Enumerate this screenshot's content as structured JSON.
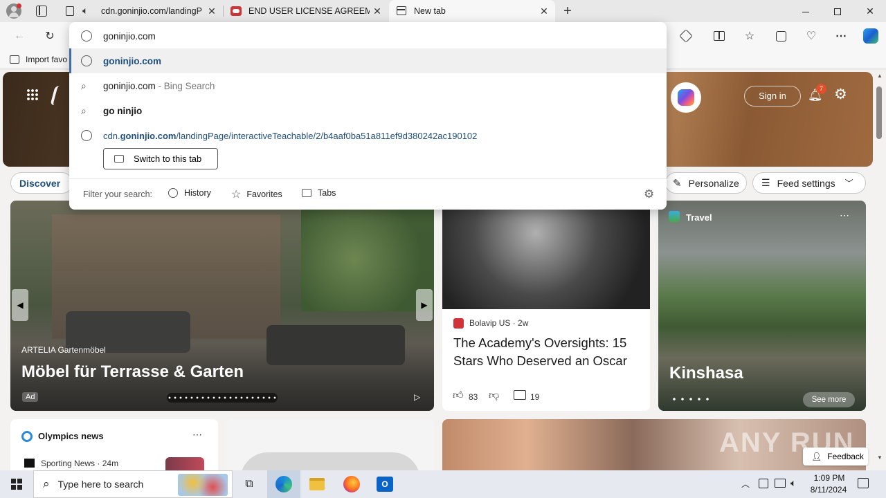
{
  "tabs": [
    {
      "title": "cdn.goninjio.com/landingP",
      "favicon": "page-icon",
      "audio": true
    },
    {
      "title": "END USER LICENSE AGREEMENT",
      "favicon": "gamepad-icon"
    },
    {
      "title": "New tab",
      "favicon": "newtab-icon",
      "active": true
    }
  ],
  "favorites_bar": {
    "import_label": "Import favo"
  },
  "omnibox": {
    "input_value": "goninjio.com",
    "suggestions": [
      {
        "text": "goninjio.com",
        "kind": "url",
        "selected": true
      },
      {
        "text": "goninjio.com",
        "suffix": " - Bing Search",
        "kind": "search"
      },
      {
        "text": "go ninjio",
        "kind": "search"
      },
      {
        "prefix": "cdn.",
        "bold": "goninjio.com",
        "rest": "/landingPage/interactiveTeachable/2/b4aaf0ba51a811ef9d380242ac190102",
        "kind": "url"
      }
    ],
    "switch_tab_label": "Switch to this tab",
    "filter_label": "Filter your search:",
    "filters": [
      "History",
      "Favorites",
      "Tabs"
    ]
  },
  "newtab": {
    "sign_in": "Sign in",
    "notification_count": "7",
    "discover": "Discover",
    "personalize": "Personalize",
    "feed_settings": "Feed settings",
    "ad_card": {
      "brand": "ARTELIA Gartenmöbel",
      "headline": "Möbel für Terrasse & Garten",
      "ad_label": "Ad"
    },
    "news_card": {
      "source": "Bolavip US",
      "age": "2w",
      "headline": "The Academy's Oversights: 15 Stars Who Deserved an Oscar",
      "likes": "83",
      "comments": "19"
    },
    "travel_card": {
      "category": "Travel",
      "place": "Kinshasa",
      "see_more": "See more"
    },
    "olympics": {
      "title": "Olympics news",
      "source": "Sporting News",
      "age": "24m"
    },
    "watermark": "ANY RUN",
    "feedback": "Feedback"
  },
  "taskbar": {
    "search_placeholder": "Type here to search",
    "time": "1:09 PM",
    "date": "8/11/2024"
  },
  "colors": {
    "accent": "#1f4f7c",
    "selected_bar": "#3e6ea5",
    "taskbar": "#e6eaf0"
  }
}
